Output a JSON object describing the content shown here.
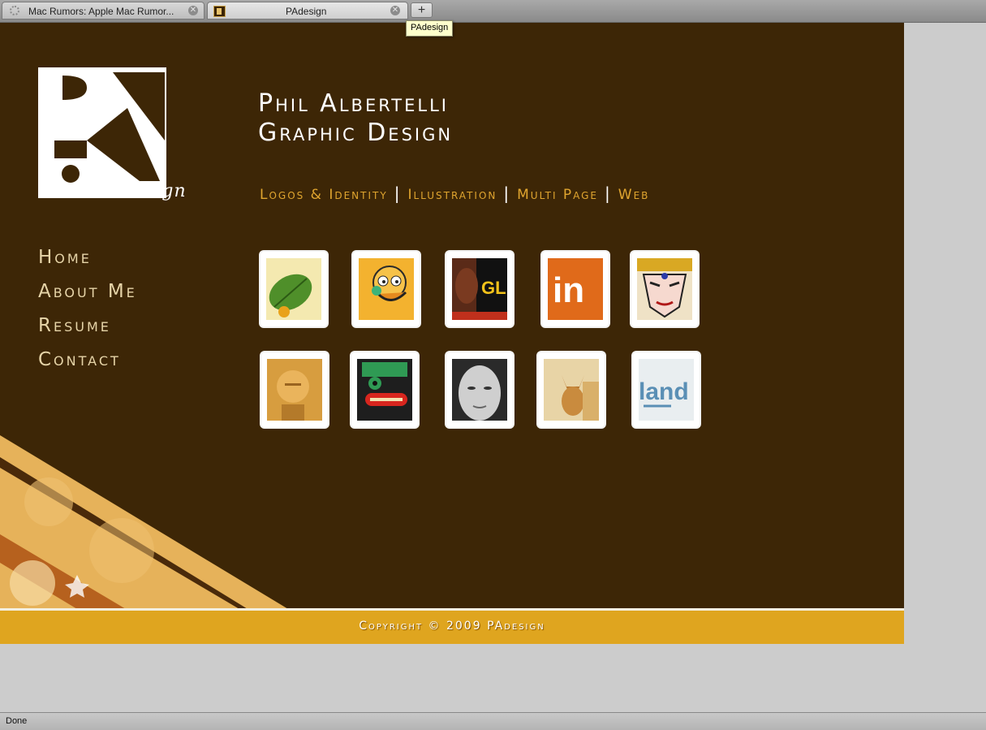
{
  "browser": {
    "tabs": [
      {
        "label": "Mac Rumors: Apple Mac Rumor...",
        "active": false
      },
      {
        "label": "PAdesign",
        "active": true
      }
    ],
    "new_tab_label": "+",
    "tooltip": "PAdesign",
    "status": "Done"
  },
  "site": {
    "logo_text": "design",
    "title_line1": "Phil Albertelli",
    "title_line2": "Graphic Design",
    "category_nav": [
      "Logos & Identity",
      "Illustration",
      "Multi Page",
      "Web"
    ],
    "main_nav": [
      "Home",
      "About Me",
      "Resume",
      "Contact"
    ],
    "footer": "Copyright © 2009 PAdesign",
    "colors": {
      "background": "#3d2606",
      "accent": "#e0a52f",
      "footer": "#dfa51f"
    }
  },
  "portfolio": {
    "thumbnails": [
      {
        "name": "leaf",
        "text": ""
      },
      {
        "name": "cartoon-duck",
        "text": ""
      },
      {
        "name": "gl-poster",
        "text": "GL"
      },
      {
        "name": "linkedin-style",
        "text": "in"
      },
      {
        "name": "comic-face",
        "text": ""
      },
      {
        "name": "golden-figure",
        "text": ""
      },
      {
        "name": "totem-mask",
        "text": ""
      },
      {
        "name": "portrait-photo",
        "text": ""
      },
      {
        "name": "dog-photo",
        "text": ""
      },
      {
        "name": "land-type",
        "text": "land"
      }
    ]
  }
}
